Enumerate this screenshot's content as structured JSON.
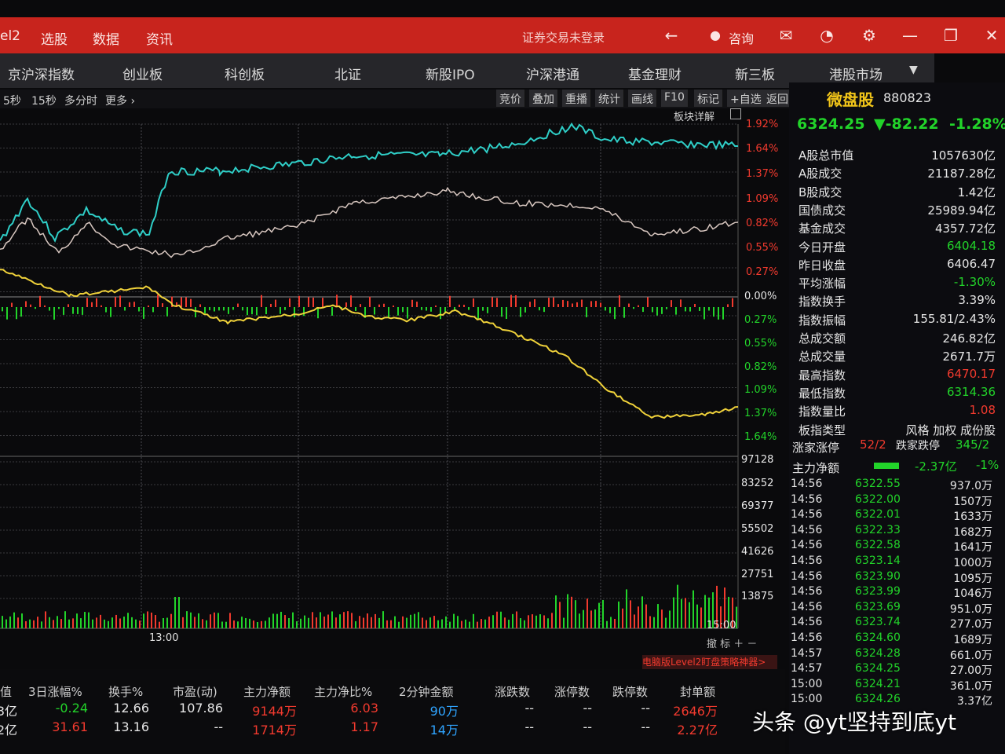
{
  "titlebar": {
    "menus": [
      "el2",
      "选股",
      "数据",
      "资讯"
    ],
    "status": "证券交易未登录",
    "consult": "咨询"
  },
  "nav": [
    "京沪深指数",
    "创业板",
    "科创板",
    "北证",
    "新股IPO",
    "沪深港通",
    "基金理财",
    "新三板",
    "港股市场"
  ],
  "subbar": {
    "periods": [
      "5秒",
      "15秒",
      "多分时",
      "更多 ›"
    ],
    "tools": [
      "竞价",
      "叠加",
      "重播",
      "统计",
      "画线",
      "F10",
      "标记",
      "+自选",
      "返回"
    ]
  },
  "chart": {
    "sector_detail": "板块详解",
    "pct_up": [
      "1.92%",
      "1.64%",
      "1.37%",
      "1.09%",
      "0.82%",
      "0.55%",
      "0.27%"
    ],
    "pct_zero": "0.00%",
    "pct_down": [
      "0.27%",
      "0.55%",
      "0.82%",
      "1.09%",
      "1.37%",
      "1.64%"
    ],
    "vol_labels": [
      "97128",
      "83252",
      "69377",
      "55502",
      "41626",
      "27751",
      "13875"
    ],
    "time_13": "13:00",
    "time_15": "15:00",
    "banner": "电脑版Level2盯盘策略神器>"
  },
  "quote": {
    "name": "微盘股",
    "code": "880823",
    "price": "6324.25",
    "change": "▼-82.22",
    "change_pct": "-1.28%",
    "rows": [
      {
        "label": "A股总市值",
        "value": "1057630亿",
        "color": "#e6e6e6"
      },
      {
        "label": "A股成交",
        "value": "21187.28亿",
        "color": "#e6e6e6"
      },
      {
        "label": "B股成交",
        "value": "1.42亿",
        "color": "#e6e6e6"
      },
      {
        "label": "国债成交",
        "value": "25989.94亿",
        "color": "#e6e6e6"
      },
      {
        "label": "基金成交",
        "value": "4357.72亿",
        "color": "#e6e6e6"
      },
      {
        "label": "今日开盘",
        "value": "6404.18",
        "color": "#22d42a"
      },
      {
        "label": "昨日收盘",
        "value": "6406.47",
        "color": "#e6e6e6"
      },
      {
        "label": "平均涨幅",
        "value": "-1.30%",
        "color": "#22d42a"
      },
      {
        "label": "指数换手",
        "value": "3.39%",
        "color": "#e6e6e6"
      },
      {
        "label": "指数振幅",
        "value": "155.81/2.43%",
        "color": "#e6e6e6"
      },
      {
        "label": "总成交额",
        "value": "246.82亿",
        "color": "#e6e6e6"
      },
      {
        "label": "总成交量",
        "value": "2671.7万",
        "color": "#e6e6e6"
      },
      {
        "label": "最高指数",
        "value": "6470.17",
        "color": "#f23a2e"
      },
      {
        "label": "最低指数",
        "value": "6314.36",
        "color": "#22d42a"
      },
      {
        "label": "指数量比",
        "value": "1.08",
        "color": "#f23a2e"
      },
      {
        "label": "板指类型",
        "value": "风格 加权 成份股",
        "color": "#e6e6e6"
      }
    ],
    "updown_label": "涨家涨停",
    "updown_value": "52/2",
    "downdown_label": "跌家跌停",
    "downdown_value": "345/2",
    "net_label": "主力净额",
    "net_value": "-2.37亿",
    "net_pct": "-1%"
  },
  "ticks": [
    {
      "t": "14:56",
      "p": "6322.55",
      "v": "937.0万"
    },
    {
      "t": "14:56",
      "p": "6322.00",
      "v": "1507万"
    },
    {
      "t": "14:56",
      "p": "6322.01",
      "v": "1633万"
    },
    {
      "t": "14:56",
      "p": "6322.33",
      "v": "1682万"
    },
    {
      "t": "14:56",
      "p": "6322.58",
      "v": "1641万"
    },
    {
      "t": "14:56",
      "p": "6323.14",
      "v": "1000万"
    },
    {
      "t": "14:56",
      "p": "6323.90",
      "v": "1095万"
    },
    {
      "t": "14:56",
      "p": "6323.99",
      "v": "1046万"
    },
    {
      "t": "14:56",
      "p": "6323.69",
      "v": "951.0万"
    },
    {
      "t": "14:56",
      "p": "6323.74",
      "v": "277.0万"
    },
    {
      "t": "14:56",
      "p": "6324.60",
      "v": "1689万"
    },
    {
      "t": "14:57",
      "p": "6324.28",
      "v": "661.0万"
    },
    {
      "t": "14:57",
      "p": "6324.25",
      "v": "27.00万"
    },
    {
      "t": "15:00",
      "p": "6324.21",
      "v": "361.0万"
    },
    {
      "t": "15:00",
      "p": "6324.26",
      "v": "3.37亿"
    }
  ],
  "bottom": {
    "headers": [
      "值",
      "3日涨幅%",
      "换手%",
      "市盈(动)",
      "主力净额",
      "主力净比%",
      "2分钟金额",
      "涨跌数",
      "涨停数",
      "跌停数",
      "封单额"
    ],
    "rows": [
      [
        "3亿",
        "-0.24",
        "12.66",
        "107.86",
        "9144万",
        "6.03",
        "90万",
        "--",
        "--",
        "--",
        "2646万"
      ],
      [
        "2亿",
        "31.61",
        "13.16",
        "--",
        "1714万",
        "1.17",
        "14万",
        "--",
        "--",
        "--",
        "2.27亿"
      ]
    ]
  },
  "watermark": "头条 @yt坚持到底yt"
}
